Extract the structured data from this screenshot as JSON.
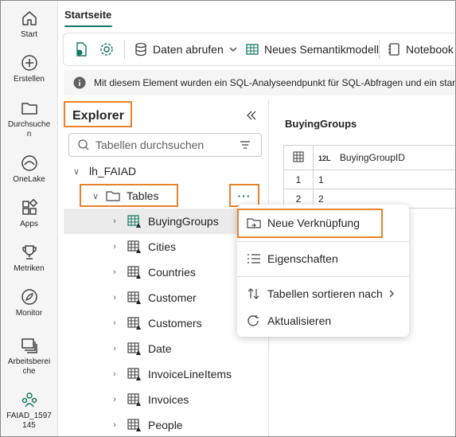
{
  "rail": {
    "items": [
      {
        "label": "Start",
        "icon": "home-icon"
      },
      {
        "label": "Erstellen",
        "icon": "plus-circle-icon"
      },
      {
        "label": "Durchsuchen",
        "icon": "folder-icon"
      },
      {
        "label": "OneLake",
        "icon": "onelake-icon"
      },
      {
        "label": "Apps",
        "icon": "apps-icon"
      },
      {
        "label": "Metriken",
        "icon": "trophy-icon"
      },
      {
        "label": "Monitor",
        "icon": "monitor-icon"
      },
      {
        "label": "Arbeitsbereiche",
        "icon": "workspaces-icon"
      },
      {
        "label": "FAIAD_1597145",
        "icon": "workspace-people-icon"
      }
    ]
  },
  "header": {
    "tab": "Startseite"
  },
  "toolbar": {
    "get_data": "Daten abrufen",
    "new_semantic_model": "Neues Semantikmodell",
    "notebook": "Notebook"
  },
  "infobar": {
    "text": "Mit diesem Element wurden ein SQL-Analyseendpunkt für SQL-Abfragen und ein stand"
  },
  "explorer": {
    "title": "Explorer",
    "search_placeholder": "Tabellen durchsuchen",
    "lakehouse": "lh_FAIAD",
    "tables_folder": "Tables",
    "more_options": "···",
    "tables": [
      "BuyingGroups",
      "Cities",
      "Countries",
      "Customer",
      "Customers",
      "Date",
      "InvoiceLineItems",
      "Invoices",
      "People"
    ]
  },
  "content": {
    "title": "BuyingGroups",
    "column_type": "12L",
    "column_name": "BuyingGroupID",
    "rows": [
      {
        "index": "1",
        "value": "1"
      },
      {
        "index": "2",
        "value": "2"
      }
    ]
  },
  "context_menu": {
    "items": [
      {
        "label": "Neue Verknüpfung",
        "icon": "folder-link-icon"
      },
      {
        "label": "Eigenschaften",
        "icon": "properties-list-icon"
      },
      {
        "label": "Tabellen sortieren nach",
        "icon": "sort-icon"
      },
      {
        "label": "Aktualisieren",
        "icon": "refresh-icon"
      }
    ]
  },
  "colors": {
    "accent": "#117865",
    "highlight": "#e8822b"
  }
}
